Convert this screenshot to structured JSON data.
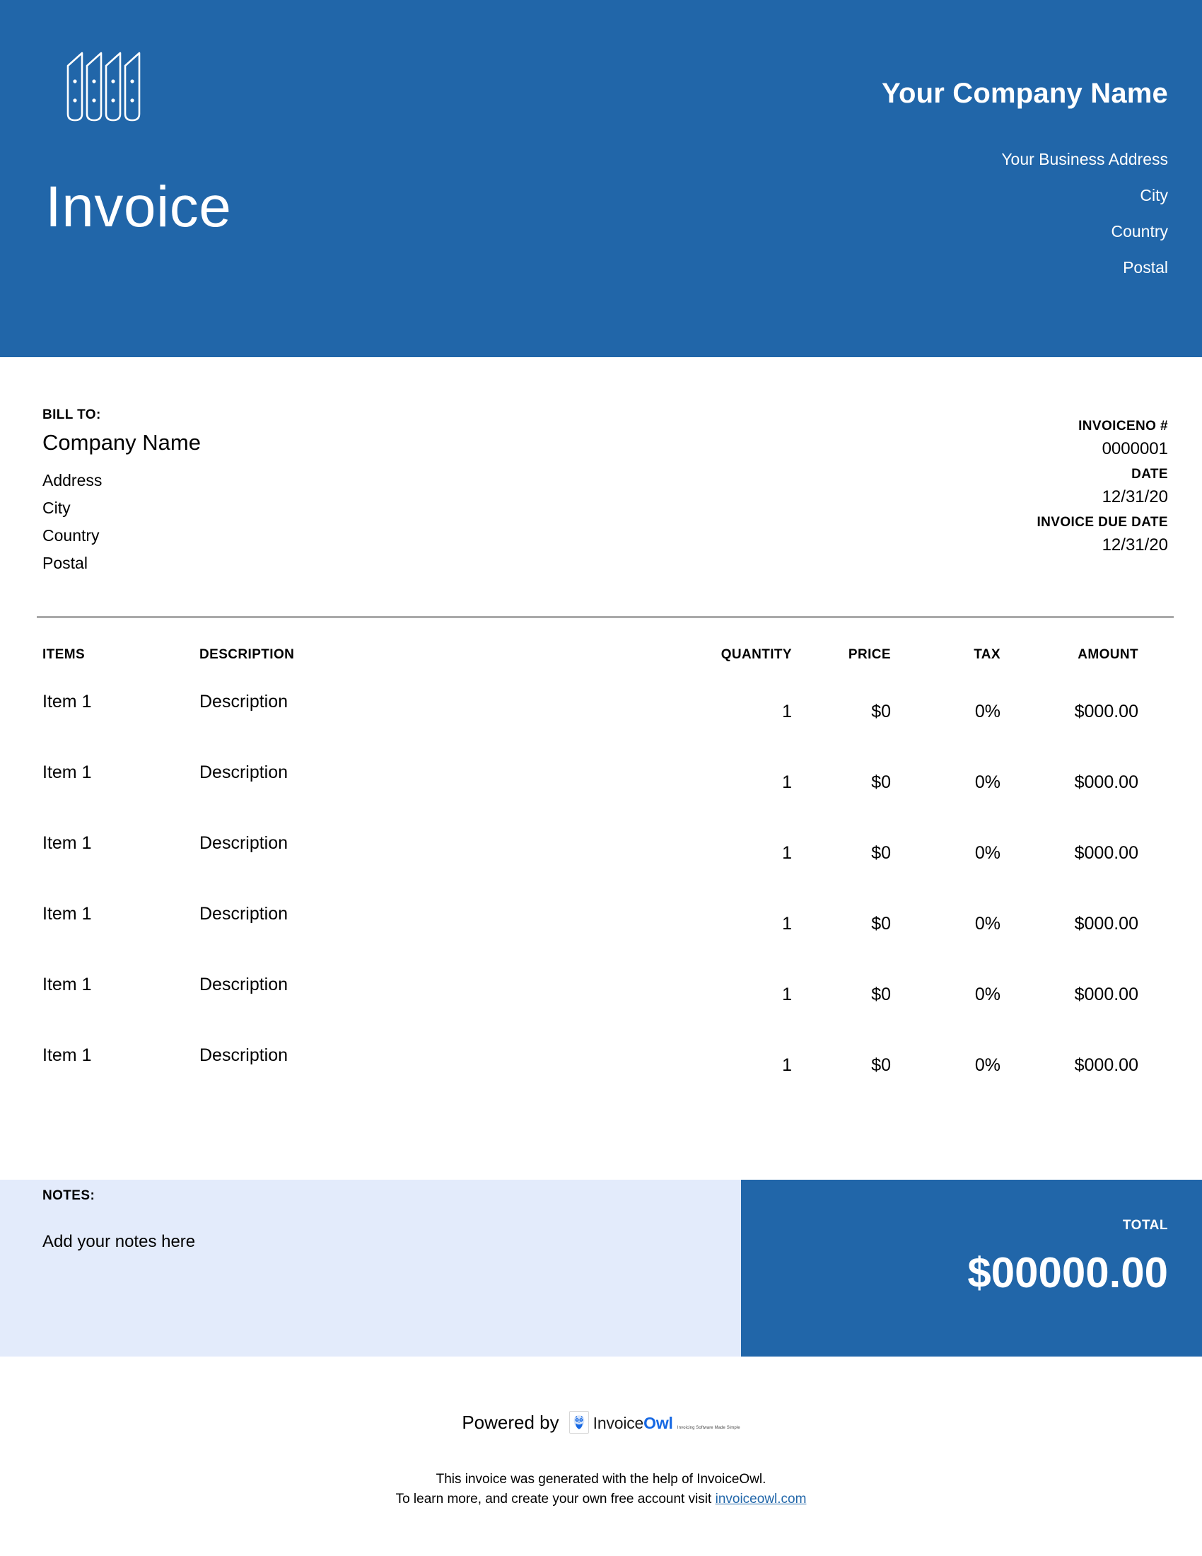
{
  "theme": {
    "brand_blue": "#2166a9",
    "notes_bg": "#e3ebfb",
    "divider": "#a9a9a9",
    "link_blue": "#2166a9"
  },
  "header": {
    "logo_icon": "building-columns-icon",
    "company_name": "Your Company Name",
    "business_lines": [
      "Your Business Address",
      "City",
      "Country",
      "Postal"
    ],
    "doc_title": "Invoice"
  },
  "bill_to": {
    "label": "BILL TO:",
    "company": "Company Name",
    "lines": [
      "Address",
      "City",
      "Country",
      "Postal"
    ]
  },
  "meta": {
    "invoice_no_label": "INVOICENO #",
    "invoice_no_value": "0000001",
    "date_label": "DATE",
    "date_value": "12/31/20",
    "due_date_label": "INVOICE DUE DATE",
    "due_date_value": "12/31/20"
  },
  "table": {
    "headers": {
      "items": "ITEMS",
      "description": "DESCRIPTION",
      "quantity": "QUANTITY",
      "price": "PRICE",
      "tax": "TAX",
      "amount": "AMOUNT"
    },
    "rows": [
      {
        "item": "Item 1",
        "description": "Description",
        "quantity": "1",
        "price": "$0",
        "tax": "0%",
        "amount": "$000.00"
      },
      {
        "item": "Item 1",
        "description": "Description",
        "quantity": "1",
        "price": "$0",
        "tax": "0%",
        "amount": "$000.00"
      },
      {
        "item": "Item 1",
        "description": "Description",
        "quantity": "1",
        "price": "$0",
        "tax": "0%",
        "amount": "$000.00"
      },
      {
        "item": "Item 1",
        "description": "Description",
        "quantity": "1",
        "price": "$0",
        "tax": "0%",
        "amount": "$000.00"
      },
      {
        "item": "Item 1",
        "description": "Description",
        "quantity": "1",
        "price": "$0",
        "tax": "0%",
        "amount": "$000.00"
      },
      {
        "item": "Item 1",
        "description": "Description",
        "quantity": "1",
        "price": "$0",
        "tax": "0%",
        "amount": "$000.00"
      }
    ]
  },
  "notes": {
    "label": "NOTES:",
    "text": "Add your notes here"
  },
  "total": {
    "label": "TOTAL",
    "value": "$00000.00"
  },
  "footer": {
    "powered_by": "Powered by",
    "brand_icon": "owl-icon",
    "brand_word_main": "Invoice",
    "brand_word_accent": "Owl",
    "brand_tagline": "Invoicing Software Made Simple",
    "legal_line_1": "This invoice was generated with the help of InvoiceOwl.",
    "legal_line_2_prefix": "To learn more, and create your own free account visit ",
    "legal_link": "invoiceowl.com"
  }
}
